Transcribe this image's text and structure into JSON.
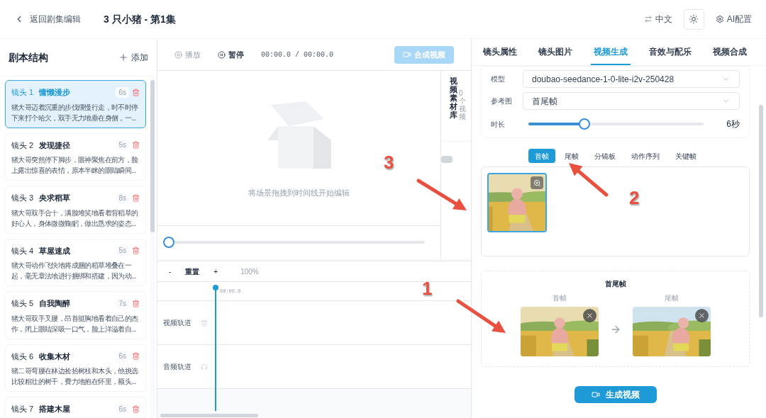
{
  "header": {
    "back": "返回剧集编辑",
    "title": "3 只小猪 - 第1集",
    "language": "中文",
    "ai_config": "AI配置"
  },
  "script": {
    "title": "剧本结构",
    "add": "添加",
    "shots": [
      {
        "label": "镜头 1",
        "name": "慵懒漫步",
        "duration": "6s",
        "text": "猪大哥迈着沉重的步伐缓慢行走，时不时停下来打个哈欠，双手无力地垂在身侧，一...",
        "selected": true
      },
      {
        "label": "镜头 2",
        "name": "发现捷径",
        "duration": "5s",
        "text": "猪大哥突然停下脚步，眼神聚焦在前方，脸上露出惊喜的表情，原本半眯的眼睛瞬间...",
        "selected": false
      },
      {
        "label": "镜头 3",
        "name": "央求稻草",
        "duration": "8s",
        "text": "猪大哥双手合十，满脸堆笑地看着背稻草的好心人，身体微微鞠躬，做出恳求的姿态...",
        "selected": false
      },
      {
        "label": "镜头 4",
        "name": "草屋速成",
        "duration": "5s",
        "text": "猪大哥动作飞快地将成捆的稻草堆叠在一起，毫无章法地进行捆绑和搭建，因为动...",
        "selected": false
      },
      {
        "label": "镜头 5",
        "name": "自我陶醉",
        "duration": "7s",
        "text": "猪大哥双手叉腰，昂首挺胸地看着自己的杰作，闭上眼睛深吸一口气，脸上洋溢着自...",
        "selected": false
      },
      {
        "label": "镜头 6",
        "name": "收集木材",
        "duration": "6s",
        "text": "猪二哥弯腰在林边捡拾树枝和木头，他挑选比较粗壮的树干，费力地抱在怀里，额头...",
        "selected": false
      },
      {
        "label": "镜头 7",
        "name": "搭建木屋",
        "duration": "6s",
        "selected": false
      }
    ]
  },
  "player": {
    "play": "播放",
    "pause": "暂停",
    "time": "00:00.0 / 00:00.0",
    "compose": "合成视频",
    "empty_hint": "将场景拖拽到时间线开始编辑",
    "progress": {
      "level": 0
    }
  },
  "library": {
    "title": "视频素材库",
    "count": "0个视频"
  },
  "timeline": {
    "zoom_out": "-",
    "reset": "重置",
    "zoom_in": "+",
    "zoom": "100%",
    "ruler_time": "00:00.0",
    "tracks": [
      {
        "name": "视频轨道",
        "kind": "video"
      },
      {
        "name": "音频轨道",
        "kind": "audio"
      }
    ]
  },
  "panel": {
    "tabs": [
      {
        "label": "镜头属性",
        "selected": false
      },
      {
        "label": "镜头图片",
        "selected": false
      },
      {
        "label": "视频生成",
        "selected": true
      },
      {
        "label": "音效与配乐",
        "selected": false
      },
      {
        "label": "视频合成",
        "selected": false
      }
    ],
    "model_label": "模型",
    "model": "doubao-seedance-1-0-lite-i2v-250428",
    "ref_label": "参考图",
    "ref": "首尾帧",
    "duration_label": "时长",
    "duration": {
      "level": 0.32
    },
    "duration_value": "6秒",
    "frame_tabs": [
      {
        "label": "首帧",
        "selected": true
      },
      {
        "label": "尾帧",
        "selected": false
      },
      {
        "label": "分镜板",
        "selected": false
      },
      {
        "label": "动作序列",
        "selected": false
      },
      {
        "label": "关键帧",
        "selected": false
      }
    ],
    "pair": {
      "title": "首尾帧",
      "first": "首帧",
      "last": "尾帧"
    },
    "generate": "生成视频"
  },
  "annotations": [
    {
      "number": "3"
    },
    {
      "number": "2"
    },
    {
      "number": "1"
    }
  ]
}
